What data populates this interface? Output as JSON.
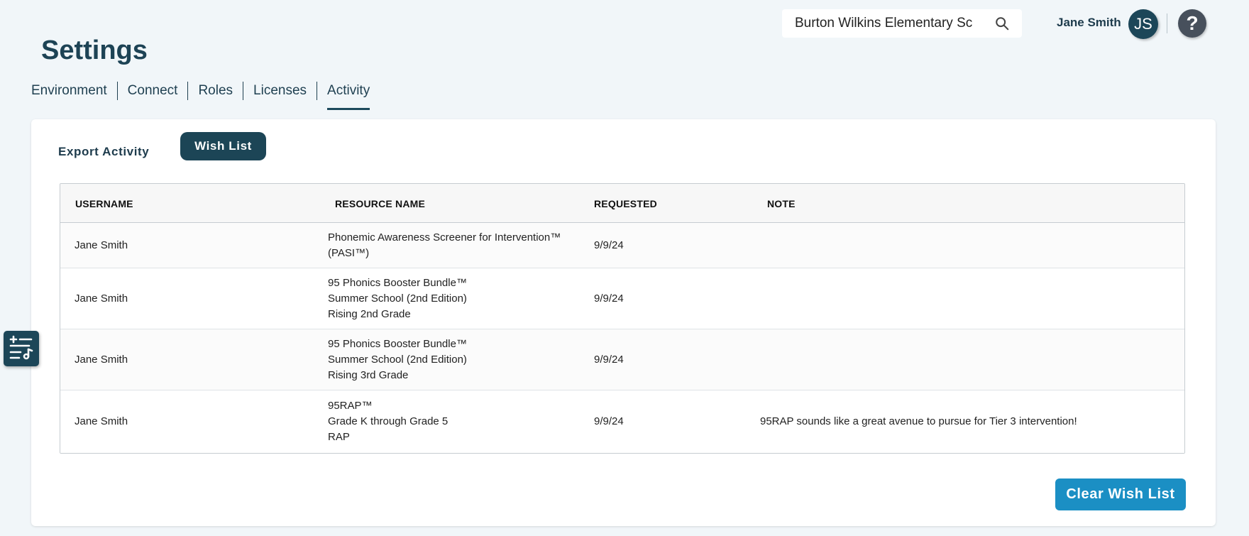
{
  "header": {
    "title": "Settings",
    "search_value": "Burton Wilkins Elementary Sc",
    "user_name": "Jane Smith",
    "avatar_initials": "JS",
    "help_label": "?"
  },
  "tabs": [
    {
      "label": "Environment",
      "active": false
    },
    {
      "label": "Connect",
      "active": false
    },
    {
      "label": "Roles",
      "active": false
    },
    {
      "label": "Licenses",
      "active": false
    },
    {
      "label": "Activity",
      "active": true
    }
  ],
  "subtabs": {
    "export_label": "Export Activity",
    "wishlist_label": "Wish List"
  },
  "table": {
    "columns": [
      "USERNAME",
      "RESOURCE NAME",
      "REQUESTED",
      "NOTE"
    ],
    "rows": [
      {
        "username": "Jane Smith",
        "resource": [
          "Phonemic Awareness Screener for Intervention™",
          "(PASI™)"
        ],
        "requested": "9/9/24",
        "note": ""
      },
      {
        "username": "Jane Smith",
        "resource": [
          "95 Phonics Booster Bundle™",
          "Summer School (2nd Edition)",
          "Rising 2nd Grade"
        ],
        "requested": "9/9/24",
        "note": ""
      },
      {
        "username": "Jane Smith",
        "resource": [
          "95 Phonics Booster Bundle™",
          "Summer School (2nd Edition)",
          "Rising 3rd Grade"
        ],
        "requested": "9/9/24",
        "note": ""
      },
      {
        "username": "Jane Smith",
        "resource": [
          "95RAP™",
          "Grade K through Grade 5",
          "RAP"
        ],
        "requested": "9/9/24",
        "note": "95RAP sounds like a great avenue to pursue for Tier 3 intervention!"
      }
    ]
  },
  "actions": {
    "clear_label": "Clear Wish List"
  },
  "icons": {
    "search": "search-icon",
    "filter_widget": "sliders-music-icon"
  },
  "colors": {
    "primary_dark": "#1c4556",
    "accent_blue": "#1b8fc4",
    "background": "#f1f6f9"
  }
}
